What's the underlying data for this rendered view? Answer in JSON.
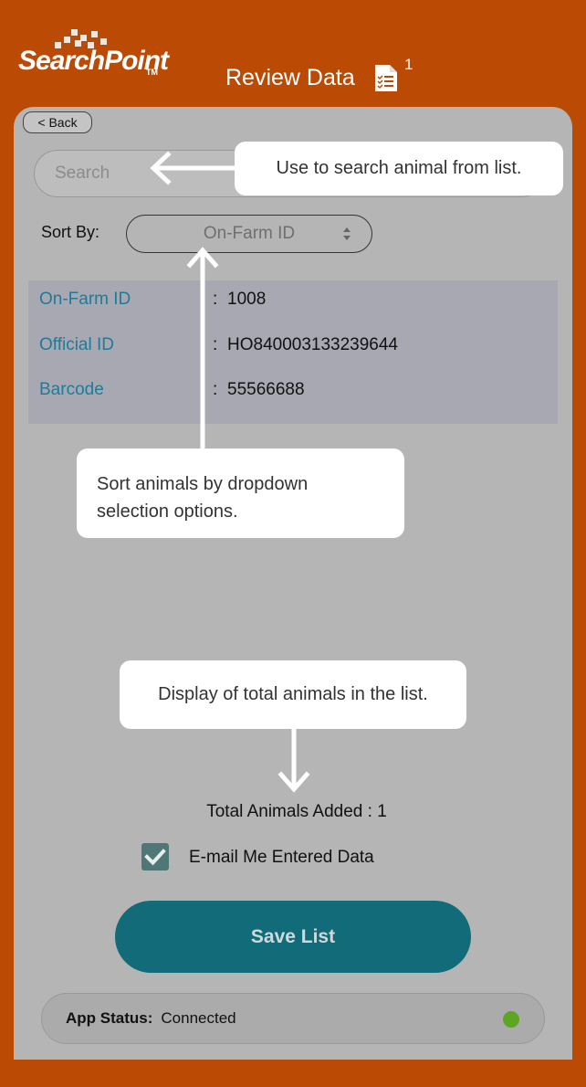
{
  "header": {
    "logo_text": "SearchPoint",
    "logo_tm": "TM",
    "title": "Review Data",
    "badge_count": "1"
  },
  "back_label": "< Back",
  "search": {
    "placeholder": "Search"
  },
  "sort": {
    "label": "Sort By:",
    "selected": "On-Farm ID"
  },
  "record": {
    "rows": [
      {
        "key": "On-Farm ID",
        "value": "1008"
      },
      {
        "key": "Official ID",
        "value": "HO840003133239644"
      },
      {
        "key": "Barcode",
        "value": "55566688"
      }
    ]
  },
  "total": {
    "label": "Total Animals Added :",
    "count": "1"
  },
  "email": {
    "label": "E-mail Me Entered Data",
    "checked": true
  },
  "save_label": "Save List",
  "status": {
    "label": "App Status:",
    "value": "Connected",
    "indicator_color": "#5FA524"
  },
  "tooltips": {
    "search": "Use to search animal from list.",
    "sort": "Sort animals by dropdown selection options.",
    "total": "Display of total animals in the list."
  },
  "colors": {
    "background": "#BB4A04",
    "panel": "#B5B5B5",
    "accent": "#126B78",
    "key_text": "#1E7C98"
  }
}
